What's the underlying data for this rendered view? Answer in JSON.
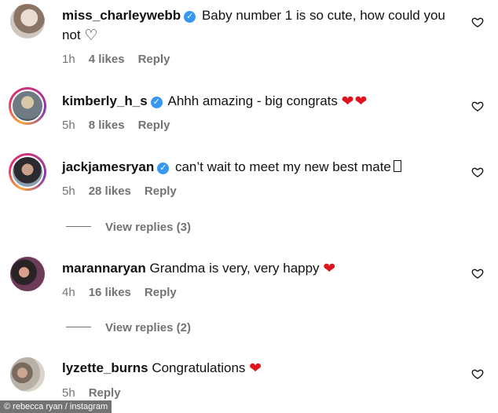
{
  "comments": [
    {
      "username": "miss_charleywebb",
      "text": "Baby number 1 is so cute, how could you not",
      "time": "1h",
      "likes": "4 likes",
      "reply": "Reply",
      "hearts": "",
      "trailing": "outline-heart"
    },
    {
      "username": "kimberly_h_s",
      "text": "Ahhh amazing - big congrats",
      "time": "5h",
      "likes": "8 likes",
      "reply": "Reply",
      "hearts": "❤❤"
    },
    {
      "username": "jackjamesryan",
      "text": "can’t wait to meet my new best mate",
      "time": "5h",
      "likes": "28 likes",
      "reply": "Reply",
      "hearts": ""
    },
    {
      "username": "marannaryan",
      "text": "Grandma is very, very happy",
      "time": "4h",
      "likes": "16 likes",
      "reply": "Reply",
      "hearts": "❤"
    },
    {
      "username": "lyzette_burns",
      "text": "Congratulations",
      "time": "5h",
      "likes": "",
      "reply": "Reply",
      "hearts": "❤"
    }
  ],
  "view_replies": [
    "View replies (3)",
    "View replies (2)"
  ],
  "credit": "© rebecca ryan / instagram",
  "colors": {
    "verified": "#3897f0",
    "heart": "#e0141e",
    "meta": "#737373"
  }
}
